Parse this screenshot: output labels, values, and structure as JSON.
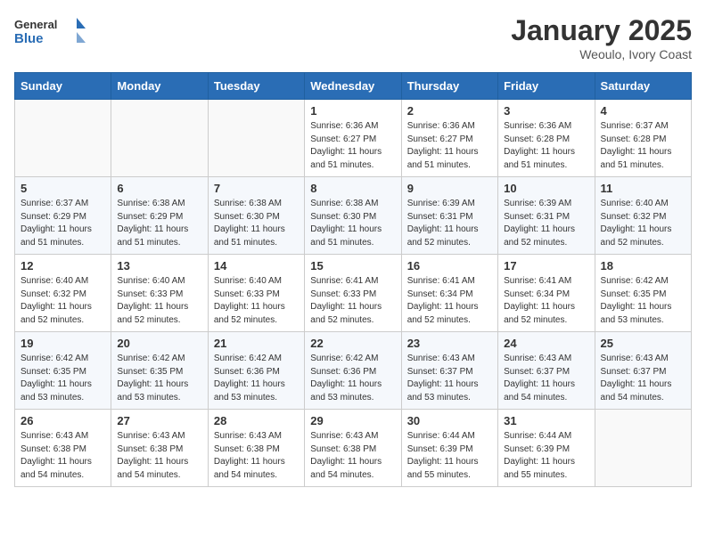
{
  "header": {
    "logo_line1": "General",
    "logo_line2": "Blue",
    "month_title": "January 2025",
    "location": "Weoulo, Ivory Coast"
  },
  "weekdays": [
    "Sunday",
    "Monday",
    "Tuesday",
    "Wednesday",
    "Thursday",
    "Friday",
    "Saturday"
  ],
  "weeks": [
    [
      {
        "day": "",
        "sunrise": "",
        "sunset": "",
        "daylight": ""
      },
      {
        "day": "",
        "sunrise": "",
        "sunset": "",
        "daylight": ""
      },
      {
        "day": "",
        "sunrise": "",
        "sunset": "",
        "daylight": ""
      },
      {
        "day": "1",
        "sunrise": "Sunrise: 6:36 AM",
        "sunset": "Sunset: 6:27 PM",
        "daylight": "Daylight: 11 hours and 51 minutes."
      },
      {
        "day": "2",
        "sunrise": "Sunrise: 6:36 AM",
        "sunset": "Sunset: 6:27 PM",
        "daylight": "Daylight: 11 hours and 51 minutes."
      },
      {
        "day": "3",
        "sunrise": "Sunrise: 6:36 AM",
        "sunset": "Sunset: 6:28 PM",
        "daylight": "Daylight: 11 hours and 51 minutes."
      },
      {
        "day": "4",
        "sunrise": "Sunrise: 6:37 AM",
        "sunset": "Sunset: 6:28 PM",
        "daylight": "Daylight: 11 hours and 51 minutes."
      }
    ],
    [
      {
        "day": "5",
        "sunrise": "Sunrise: 6:37 AM",
        "sunset": "Sunset: 6:29 PM",
        "daylight": "Daylight: 11 hours and 51 minutes."
      },
      {
        "day": "6",
        "sunrise": "Sunrise: 6:38 AM",
        "sunset": "Sunset: 6:29 PM",
        "daylight": "Daylight: 11 hours and 51 minutes."
      },
      {
        "day": "7",
        "sunrise": "Sunrise: 6:38 AM",
        "sunset": "Sunset: 6:30 PM",
        "daylight": "Daylight: 11 hours and 51 minutes."
      },
      {
        "day": "8",
        "sunrise": "Sunrise: 6:38 AM",
        "sunset": "Sunset: 6:30 PM",
        "daylight": "Daylight: 11 hours and 51 minutes."
      },
      {
        "day": "9",
        "sunrise": "Sunrise: 6:39 AM",
        "sunset": "Sunset: 6:31 PM",
        "daylight": "Daylight: 11 hours and 52 minutes."
      },
      {
        "day": "10",
        "sunrise": "Sunrise: 6:39 AM",
        "sunset": "Sunset: 6:31 PM",
        "daylight": "Daylight: 11 hours and 52 minutes."
      },
      {
        "day": "11",
        "sunrise": "Sunrise: 6:40 AM",
        "sunset": "Sunset: 6:32 PM",
        "daylight": "Daylight: 11 hours and 52 minutes."
      }
    ],
    [
      {
        "day": "12",
        "sunrise": "Sunrise: 6:40 AM",
        "sunset": "Sunset: 6:32 PM",
        "daylight": "Daylight: 11 hours and 52 minutes."
      },
      {
        "day": "13",
        "sunrise": "Sunrise: 6:40 AM",
        "sunset": "Sunset: 6:33 PM",
        "daylight": "Daylight: 11 hours and 52 minutes."
      },
      {
        "day": "14",
        "sunrise": "Sunrise: 6:40 AM",
        "sunset": "Sunset: 6:33 PM",
        "daylight": "Daylight: 11 hours and 52 minutes."
      },
      {
        "day": "15",
        "sunrise": "Sunrise: 6:41 AM",
        "sunset": "Sunset: 6:33 PM",
        "daylight": "Daylight: 11 hours and 52 minutes."
      },
      {
        "day": "16",
        "sunrise": "Sunrise: 6:41 AM",
        "sunset": "Sunset: 6:34 PM",
        "daylight": "Daylight: 11 hours and 52 minutes."
      },
      {
        "day": "17",
        "sunrise": "Sunrise: 6:41 AM",
        "sunset": "Sunset: 6:34 PM",
        "daylight": "Daylight: 11 hours and 52 minutes."
      },
      {
        "day": "18",
        "sunrise": "Sunrise: 6:42 AM",
        "sunset": "Sunset: 6:35 PM",
        "daylight": "Daylight: 11 hours and 53 minutes."
      }
    ],
    [
      {
        "day": "19",
        "sunrise": "Sunrise: 6:42 AM",
        "sunset": "Sunset: 6:35 PM",
        "daylight": "Daylight: 11 hours and 53 minutes."
      },
      {
        "day": "20",
        "sunrise": "Sunrise: 6:42 AM",
        "sunset": "Sunset: 6:35 PM",
        "daylight": "Daylight: 11 hours and 53 minutes."
      },
      {
        "day": "21",
        "sunrise": "Sunrise: 6:42 AM",
        "sunset": "Sunset: 6:36 PM",
        "daylight": "Daylight: 11 hours and 53 minutes."
      },
      {
        "day": "22",
        "sunrise": "Sunrise: 6:42 AM",
        "sunset": "Sunset: 6:36 PM",
        "daylight": "Daylight: 11 hours and 53 minutes."
      },
      {
        "day": "23",
        "sunrise": "Sunrise: 6:43 AM",
        "sunset": "Sunset: 6:37 PM",
        "daylight": "Daylight: 11 hours and 53 minutes."
      },
      {
        "day": "24",
        "sunrise": "Sunrise: 6:43 AM",
        "sunset": "Sunset: 6:37 PM",
        "daylight": "Daylight: 11 hours and 54 minutes."
      },
      {
        "day": "25",
        "sunrise": "Sunrise: 6:43 AM",
        "sunset": "Sunset: 6:37 PM",
        "daylight": "Daylight: 11 hours and 54 minutes."
      }
    ],
    [
      {
        "day": "26",
        "sunrise": "Sunrise: 6:43 AM",
        "sunset": "Sunset: 6:38 PM",
        "daylight": "Daylight: 11 hours and 54 minutes."
      },
      {
        "day": "27",
        "sunrise": "Sunrise: 6:43 AM",
        "sunset": "Sunset: 6:38 PM",
        "daylight": "Daylight: 11 hours and 54 minutes."
      },
      {
        "day": "28",
        "sunrise": "Sunrise: 6:43 AM",
        "sunset": "Sunset: 6:38 PM",
        "daylight": "Daylight: 11 hours and 54 minutes."
      },
      {
        "day": "29",
        "sunrise": "Sunrise: 6:43 AM",
        "sunset": "Sunset: 6:38 PM",
        "daylight": "Daylight: 11 hours and 54 minutes."
      },
      {
        "day": "30",
        "sunrise": "Sunrise: 6:44 AM",
        "sunset": "Sunset: 6:39 PM",
        "daylight": "Daylight: 11 hours and 55 minutes."
      },
      {
        "day": "31",
        "sunrise": "Sunrise: 6:44 AM",
        "sunset": "Sunset: 6:39 PM",
        "daylight": "Daylight: 11 hours and 55 minutes."
      },
      {
        "day": "",
        "sunrise": "",
        "sunset": "",
        "daylight": ""
      }
    ]
  ]
}
